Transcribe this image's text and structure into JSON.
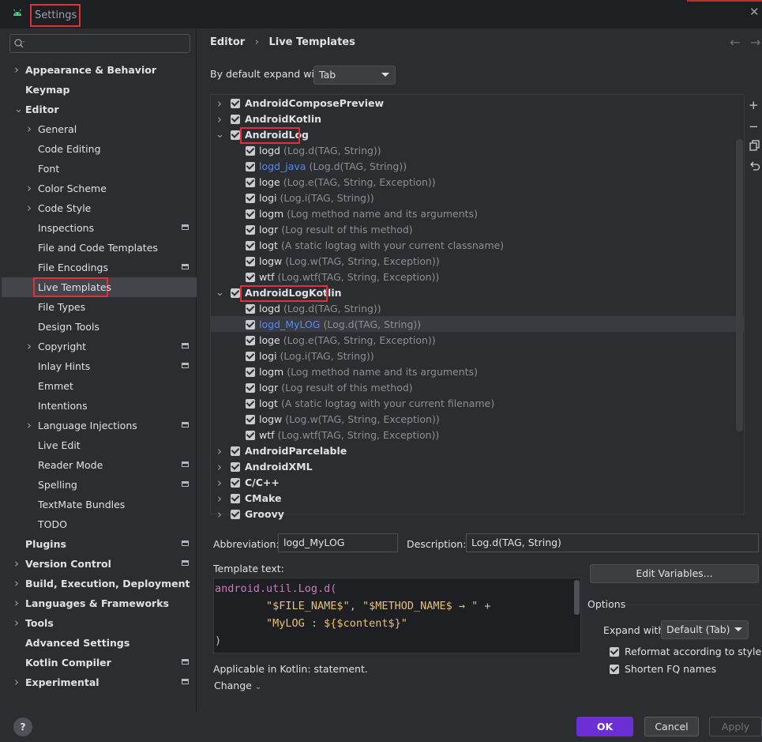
{
  "window": {
    "title": "Settings",
    "close_glyph": "✕"
  },
  "search": {
    "placeholder": ""
  },
  "sidebar": {
    "items": [
      {
        "label": "Appearance & Behavior"
      },
      {
        "label": "Keymap"
      },
      {
        "label": "Editor"
      },
      {
        "label": "General"
      },
      {
        "label": "Code Editing"
      },
      {
        "label": "Font"
      },
      {
        "label": "Color Scheme"
      },
      {
        "label": "Code Style"
      },
      {
        "label": "Inspections"
      },
      {
        "label": "File and Code Templates"
      },
      {
        "label": "File Encodings"
      },
      {
        "label": "Live Templates"
      },
      {
        "label": "File Types"
      },
      {
        "label": "Design Tools"
      },
      {
        "label": "Copyright"
      },
      {
        "label": "Inlay Hints"
      },
      {
        "label": "Emmet"
      },
      {
        "label": "Intentions"
      },
      {
        "label": "Language Injections"
      },
      {
        "label": "Live Edit"
      },
      {
        "label": "Reader Mode"
      },
      {
        "label": "Spelling"
      },
      {
        "label": "TextMate Bundles"
      },
      {
        "label": "TODO"
      },
      {
        "label": "Plugins"
      },
      {
        "label": "Version Control"
      },
      {
        "label": "Build, Execution, Deployment"
      },
      {
        "label": "Languages & Frameworks"
      },
      {
        "label": "Tools"
      },
      {
        "label": "Advanced Settings"
      },
      {
        "label": "Kotlin Compiler"
      },
      {
        "label": "Experimental"
      }
    ]
  },
  "header": {
    "breadcrumb_parent": "Editor",
    "breadcrumb_sep": "›",
    "breadcrumb_current": "Live Templates",
    "expand_label": "By default expand with",
    "expand_value": "Tab"
  },
  "templates": {
    "groups": [
      {
        "name": "AndroidComposePreview"
      },
      {
        "name": "AndroidKotlin"
      },
      {
        "name": "AndroidLog",
        "items": [
          {
            "abbr": "logd",
            "desc": "(Log.d(TAG, String))"
          },
          {
            "abbr": "logd_java",
            "desc": "(Log.d(TAG, String))"
          },
          {
            "abbr": "loge",
            "desc": "(Log.e(TAG, String, Exception))"
          },
          {
            "abbr": "logi",
            "desc": "(Log.i(TAG, String))"
          },
          {
            "abbr": "logm",
            "desc": "(Log method name and its arguments)"
          },
          {
            "abbr": "logr",
            "desc": "(Log result of this method)"
          },
          {
            "abbr": "logt",
            "desc": "(A static logtag with your current classname)"
          },
          {
            "abbr": "logw",
            "desc": "(Log.w(TAG, String, Exception))"
          },
          {
            "abbr": "wtf",
            "desc": "(Log.wtf(TAG, String, Exception))"
          }
        ]
      },
      {
        "name": "AndroidLogKotlin",
        "items": [
          {
            "abbr": "logd",
            "desc": "(Log.d(TAG, String))"
          },
          {
            "abbr": "logd_MyLOG",
            "desc": "(Log.d(TAG, String))"
          },
          {
            "abbr": "loge",
            "desc": "(Log.e(TAG, String, Exception))"
          },
          {
            "abbr": "logi",
            "desc": "(Log.i(TAG, String))"
          },
          {
            "abbr": "logm",
            "desc": "(Log method name and its arguments)"
          },
          {
            "abbr": "logr",
            "desc": "(Log result of this method)"
          },
          {
            "abbr": "logt",
            "desc": "(A static logtag with your current filename)"
          },
          {
            "abbr": "logw",
            "desc": "(Log.w(TAG, String, Exception))"
          },
          {
            "abbr": "wtf",
            "desc": "(Log.wtf(TAG, String, Exception))"
          }
        ]
      },
      {
        "name": "AndroidParcelable"
      },
      {
        "name": "AndroidXML"
      },
      {
        "name": "C/C++"
      },
      {
        "name": "CMake"
      },
      {
        "name": "Groovy"
      }
    ]
  },
  "editor": {
    "abbreviation_label": "Abbreviation:",
    "abbreviation_value": "logd_MyLOG",
    "description_label": "Description:",
    "description_value": "Log.d(TAG, String)",
    "template_text_label": "Template text:",
    "code": {
      "l1": "android.util.Log.d(",
      "l2_a": "\"$FILE_NAME$\"",
      "l2_b": ", ",
      "l2_c": "\"$METHOD_NAME$",
      "l2_d": " → ",
      "l2_e": "\" +",
      "l3": "\"MyLOG : ${$content$}\"",
      "l4": ")"
    },
    "applicable": "Applicable in Kotlin: statement.",
    "change": "Change"
  },
  "options": {
    "edit_variables": "Edit Variables...",
    "title": "Options",
    "expand_with_label": "Expand with",
    "expand_with_value": "Default (Tab)",
    "reformat": "Reformat according to style",
    "shorten": "Shorten FQ names"
  },
  "footer": {
    "help": "?",
    "ok": "OK",
    "cancel": "Cancel",
    "apply": "Apply"
  },
  "colors": {
    "accent": "#6b2fd6",
    "highlight_box": "#e0313b",
    "link": "#548af7"
  }
}
